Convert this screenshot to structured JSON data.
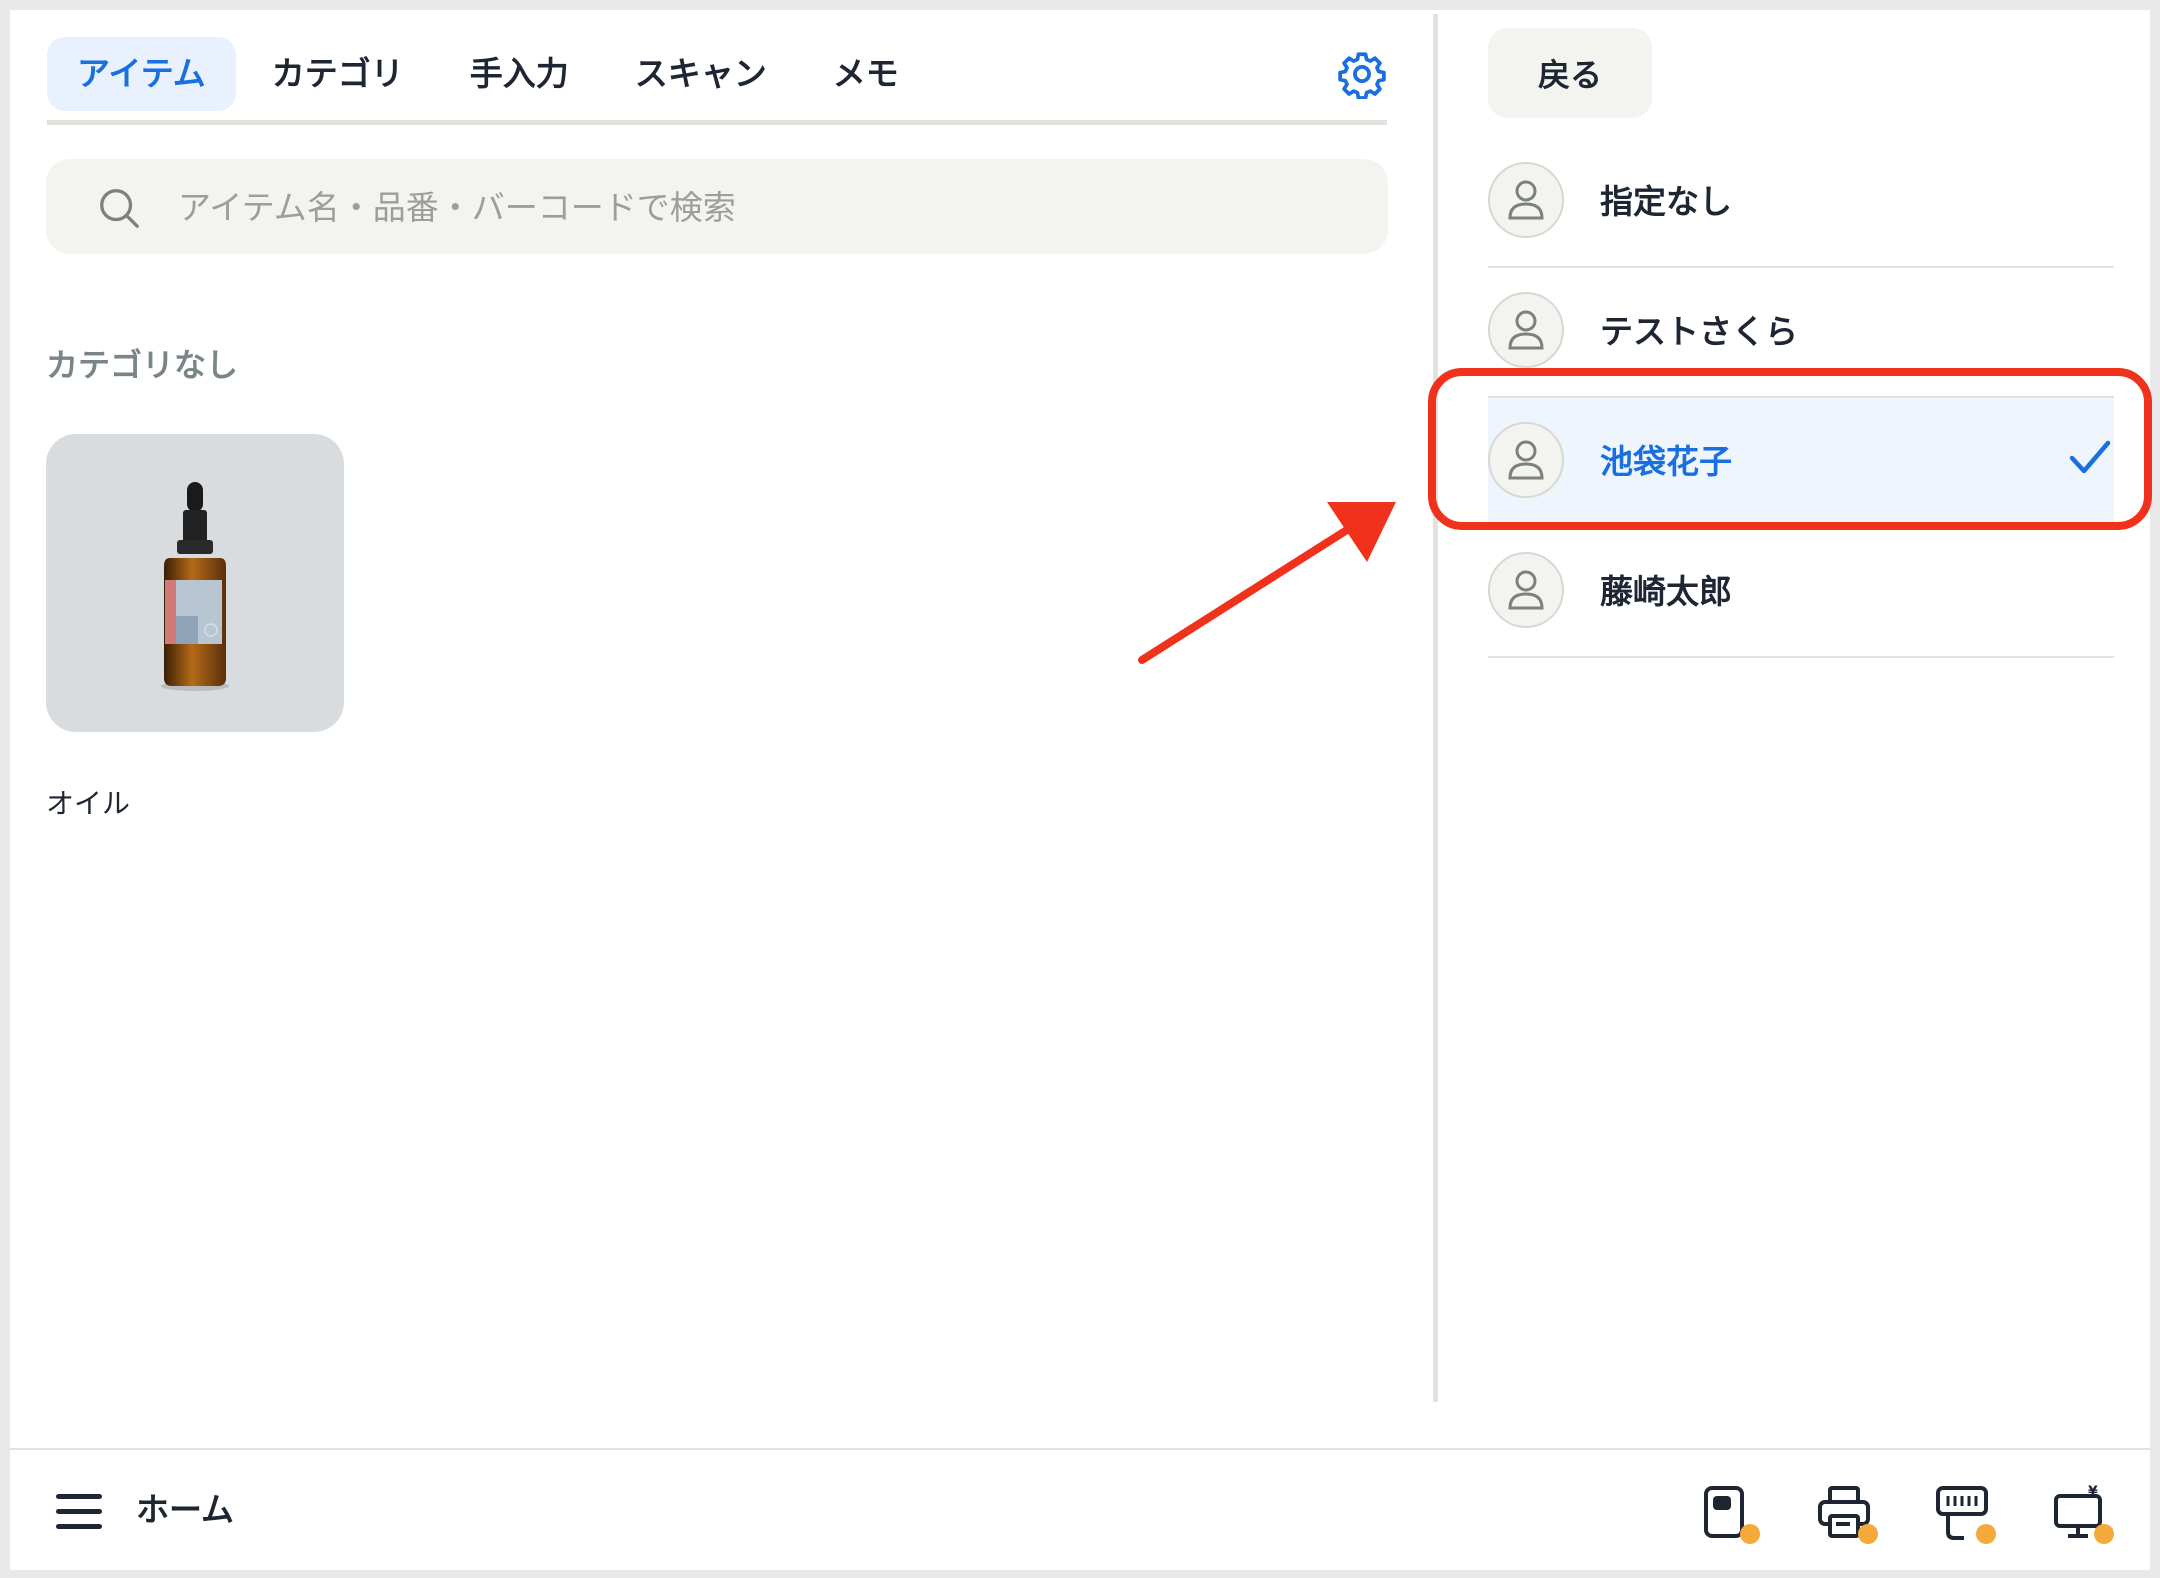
{
  "tabs": [
    {
      "label": "アイテム",
      "active": true
    },
    {
      "label": "カテゴリ",
      "active": false
    },
    {
      "label": "手入力",
      "active": false
    },
    {
      "label": "スキャン",
      "active": false
    },
    {
      "label": "メモ",
      "active": false
    }
  ],
  "search": {
    "placeholder": "アイテム名・品番・バーコードで検索",
    "icon": "search-icon"
  },
  "section": {
    "title": "カテゴリなし"
  },
  "items": [
    {
      "label": "オイル",
      "icon": "dropper-bottle-image"
    }
  ],
  "staff_panel": {
    "back_label": "戻る",
    "staff": [
      {
        "name": "指定なし",
        "selected": false
      },
      {
        "name": "テストさくら",
        "selected": false
      },
      {
        "name": "池袋花子",
        "selected": true
      },
      {
        "name": "藤崎太郎",
        "selected": false
      }
    ]
  },
  "bottom_bar": {
    "home_label": "ホーム",
    "devices": [
      "card-reader-icon",
      "printer-icon",
      "barcode-scanner-icon",
      "customer-display-icon"
    ]
  },
  "colors": {
    "accent": "#1a6fe0",
    "annotation_red": "#f0321c",
    "status_dot": "#f6a93b",
    "selected_bg": "#eef5fd"
  }
}
